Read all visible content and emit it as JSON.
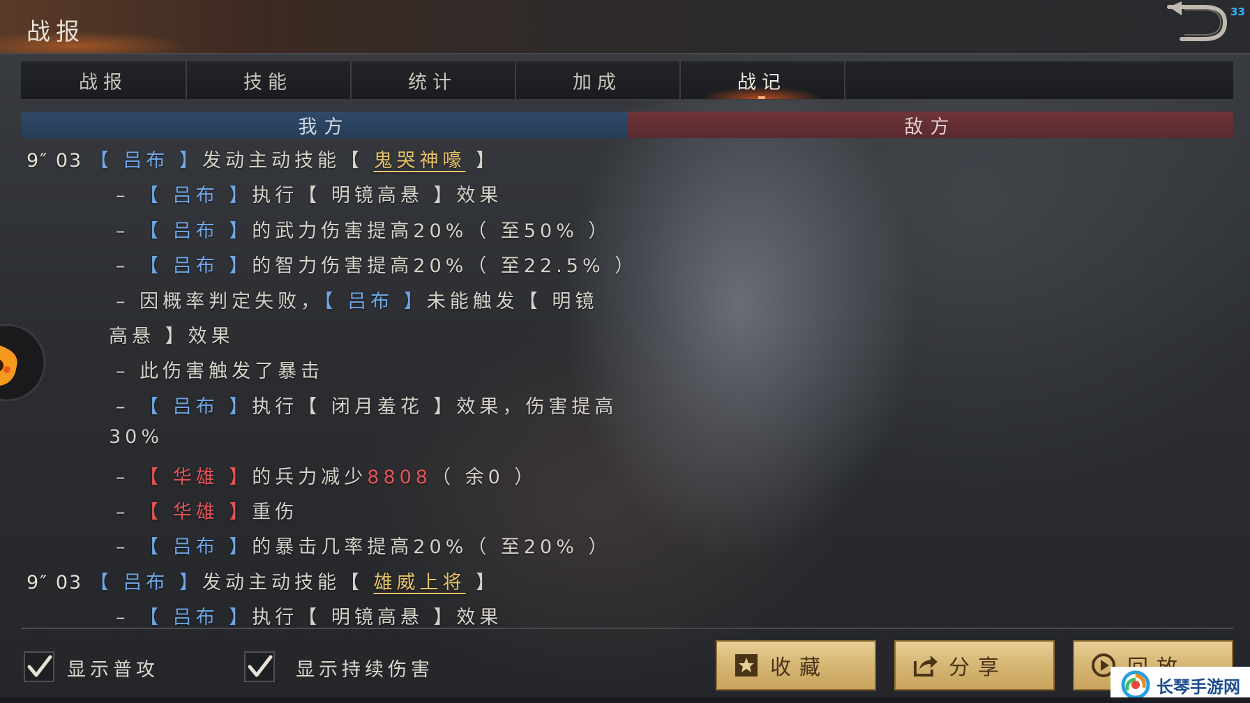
{
  "header": {
    "title": "战报",
    "back_icon": "return-arrow-icon",
    "fps": "33"
  },
  "tabs": [
    {
      "label": "战报",
      "active": false
    },
    {
      "label": "技能",
      "active": false
    },
    {
      "label": "统计",
      "active": false
    },
    {
      "label": "加成",
      "active": false
    },
    {
      "label": "战记",
      "active": true
    }
  ],
  "sides": {
    "ours": "我方",
    "enemy": "敌方"
  },
  "log": {
    "lines": [
      {
        "segments": [
          {
            "text": "9″ 03 ",
            "style": "time"
          },
          {
            "text": "【 吕布 】",
            "style": "blue"
          },
          {
            "text": "发动主动技能",
            "style": "plain"
          },
          {
            "text": "【 ",
            "style": "plain"
          },
          {
            "text": "鬼哭神嚎",
            "style": "skill"
          },
          {
            "text": " 】",
            "style": "plain"
          }
        ]
      },
      {
        "segments": [
          {
            "text": "– ",
            "style": "plain"
          },
          {
            "text": "【 吕布 】",
            "style": "blue"
          },
          {
            "text": "执行【 明镜高悬 】效果",
            "style": "plain"
          }
        ]
      },
      {
        "segments": [
          {
            "text": "– ",
            "style": "plain"
          },
          {
            "text": "【 吕布 】",
            "style": "blue"
          },
          {
            "text": "的武力伤害提高20%（ 至50% ）",
            "style": "plain"
          }
        ]
      },
      {
        "segments": [
          {
            "text": "– ",
            "style": "plain"
          },
          {
            "text": "【 吕布 】",
            "style": "blue"
          },
          {
            "text": "的智力伤害提高20%（ 至22.5% ）",
            "style": "plain"
          }
        ]
      },
      {
        "segments": [
          {
            "text": "– 因概率判定失败，",
            "style": "plain"
          },
          {
            "text": "【 吕布 】",
            "style": "blue"
          },
          {
            "text": "未能触发【 明镜",
            "style": "plain"
          }
        ]
      },
      {
        "segments": [
          {
            "text": "高悬 】效果",
            "style": "plain"
          }
        ]
      },
      {
        "segments": [
          {
            "text": "– 此伤害触发了暴击",
            "style": "plain"
          }
        ]
      },
      {
        "segments": [
          {
            "text": "– ",
            "style": "plain"
          },
          {
            "text": "【 吕布 】",
            "style": "blue"
          },
          {
            "text": "执行【 闭月羞花 】效果，伤害提高",
            "style": "plain"
          }
        ]
      },
      {
        "segments": [
          {
            "text": "30%",
            "style": "plain"
          }
        ]
      },
      {
        "segments": [
          {
            "text": "– ",
            "style": "plain"
          },
          {
            "text": "【 华雄 】",
            "style": "red"
          },
          {
            "text": "的兵力减少",
            "style": "plain"
          },
          {
            "text": "8808",
            "style": "red"
          },
          {
            "text": "（ 余0 ）",
            "style": "plain"
          }
        ]
      },
      {
        "segments": [
          {
            "text": "– ",
            "style": "plain"
          },
          {
            "text": "【 华雄 】",
            "style": "red"
          },
          {
            "text": "重伤",
            "style": "plain"
          }
        ]
      },
      {
        "segments": [
          {
            "text": "– ",
            "style": "plain"
          },
          {
            "text": "【 吕布 】",
            "style": "blue"
          },
          {
            "text": "的暴击几率提高20%（ 至20% ）",
            "style": "plain"
          }
        ]
      },
      {
        "segments": [
          {
            "text": "9″ 03 ",
            "style": "time"
          },
          {
            "text": "【 吕布 】",
            "style": "blue"
          },
          {
            "text": "发动主动技能",
            "style": "plain"
          },
          {
            "text": "【 ",
            "style": "plain"
          },
          {
            "text": "雄威上将",
            "style": "skill"
          },
          {
            "text": " 】",
            "style": "plain"
          }
        ]
      },
      {
        "segments": [
          {
            "text": "– ",
            "style": "plain"
          },
          {
            "text": "【 吕布 】",
            "style": "blue"
          },
          {
            "text": "执行【 明镜高悬 】效果",
            "style": "plain"
          }
        ]
      }
    ]
  },
  "options": {
    "show_normal_attack": {
      "label": "显示普攻",
      "checked": true
    },
    "show_dot_damage": {
      "label": "显示持续伤害",
      "checked": true
    }
  },
  "actions": {
    "favorite": {
      "label": "收藏",
      "icon": "star-icon"
    },
    "share": {
      "label": "分享",
      "icon": "share-icon"
    },
    "replay": {
      "label": "回放",
      "icon": "play-icon"
    }
  },
  "watermark": {
    "text": "长琴手游网",
    "icon": "swirl-logo-icon"
  },
  "colors": {
    "ally_blue": "#6fa6e6",
    "enemy_red": "#e35454",
    "skill_gold": "#e8c46a",
    "tab_active_glow": "#e65a1e",
    "button_gold": "#d6b674"
  }
}
